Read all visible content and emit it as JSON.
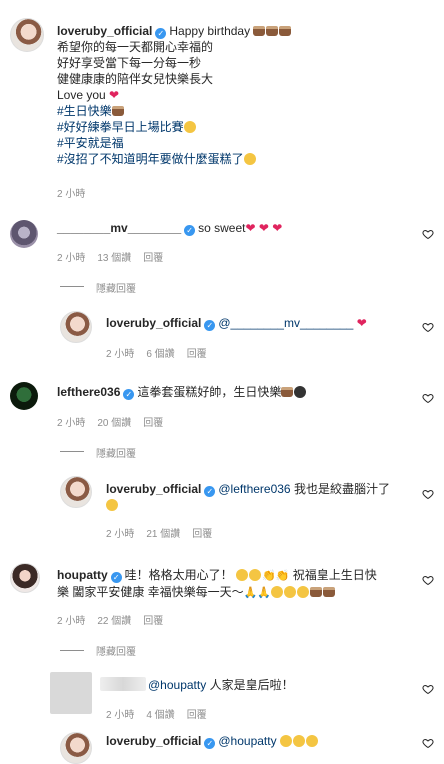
{
  "post": {
    "username": "loveruby_official",
    "header": "Happy birthday",
    "lines": [
      "希望你的每一天都開心幸福的",
      "好好享受當下每一分每一秒",
      "健健康康的陪伴女兒快樂長大",
      "Love you"
    ],
    "hashtags": [
      "#生日快樂",
      "#好好練拳早日上場比賽",
      "#平安就是福",
      "#沒招了不知道明年要做什麼蛋糕了"
    ],
    "time": "2 小時"
  },
  "comments": [
    {
      "username": "________mv________",
      "text": "so sweet",
      "time": "2 小時",
      "likes": "13 個讚",
      "reply": "回覆",
      "hide_replies": "隱藏回覆",
      "replies": [
        {
          "username": "loveruby_official",
          "mention": "@________mv________",
          "text": "",
          "time": "2 小時",
          "likes": "6 個讚",
          "reply": "回覆"
        }
      ]
    },
    {
      "username": "lefthere036",
      "text": "這拳套蛋糕好帥，生日快樂",
      "time": "2 小時",
      "likes": "20 個讚",
      "reply": "回覆",
      "hide_replies": "隱藏回覆",
      "replies": [
        {
          "username": "loveruby_official",
          "mention": "@lefthere036",
          "text": "我也是絞盡腦汁了",
          "time": "2 小時",
          "likes": "21 個讚",
          "reply": "回覆"
        }
      ]
    },
    {
      "username": "houpatty",
      "text_line1": "哇！格格太用心了！",
      "text_line1b": "祝福皇上生日快",
      "text_line2": "樂 闔家平安健康 幸福快樂每一天～",
      "time": "2 小時",
      "likes": "22 個讚",
      "reply": "回覆",
      "hide_replies": "隱藏回覆",
      "replies": [
        {
          "mention": "@houpatty",
          "text": "人家是皇后啦！",
          "time": "2 小時",
          "likes": "4 個讚",
          "reply": "回覆"
        },
        {
          "username": "loveruby_official",
          "mention": "@houpatty",
          "text": ""
        }
      ]
    }
  ]
}
